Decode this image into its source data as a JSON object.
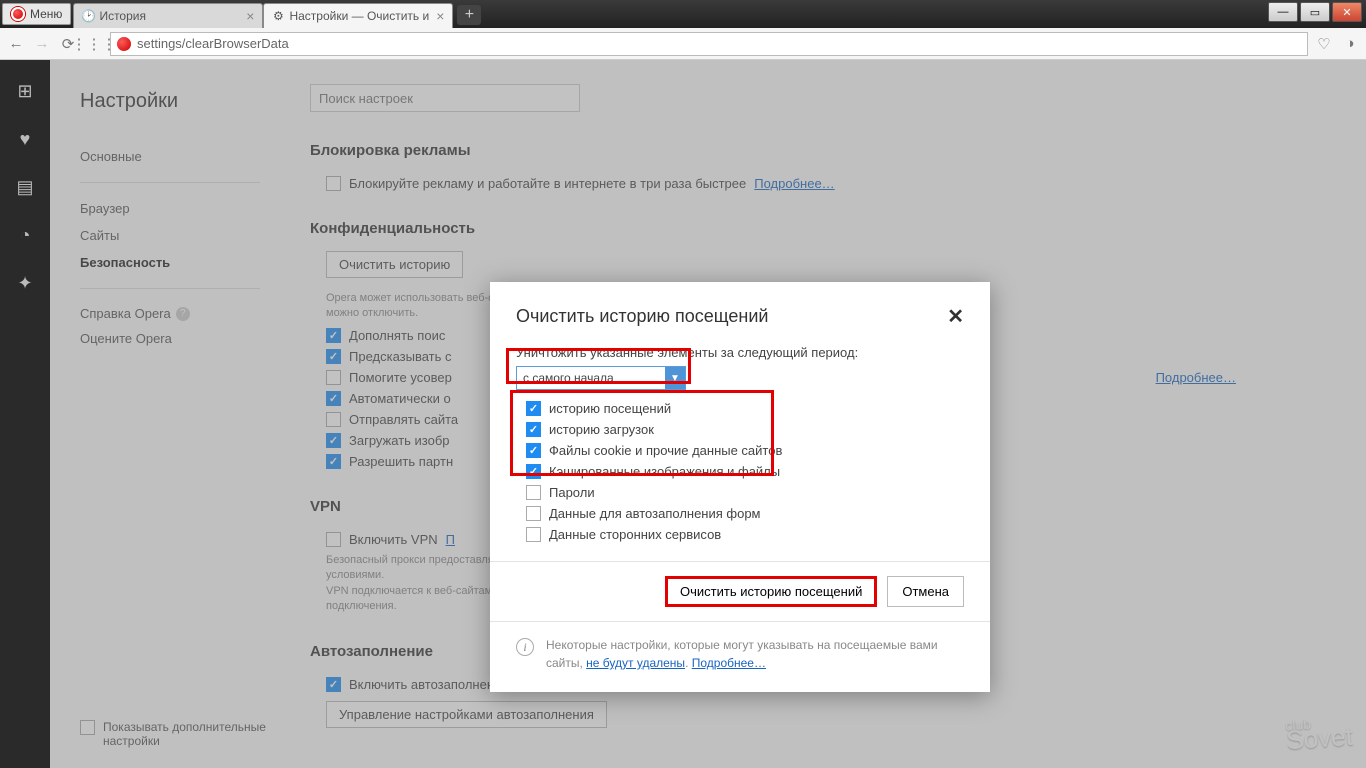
{
  "menu_label": "Меню",
  "tabs": [
    {
      "label": "История"
    },
    {
      "label": "Настройки — Очистить и"
    }
  ],
  "url": "settings/clearBrowserData",
  "sidebar": {
    "title": "Настройки",
    "items": [
      "Основные",
      "Браузер",
      "Сайты",
      "Безопасность"
    ],
    "help": "Справка Opera",
    "rate": "Оцените Opera",
    "advanced": "Показывать дополнительные настройки"
  },
  "search_placeholder": "Поиск настроек",
  "sections": {
    "ads": {
      "title": "Блокировка рекламы",
      "row": "Блокируйте рекламу и работайте в интернете в три раза быстрее",
      "more": "Подробнее…"
    },
    "privacy": {
      "title": "Конфиденциальность",
      "clear_btn": "Очистить историю",
      "desc": "Opera может использовать веб-службы для улучшения качества работы в интернете. При необходимости эти службы можно отключить.",
      "more": "Подробнее…",
      "rows": [
        "Дополнять поис",
        "Предсказывать с",
        "Помогите усовер",
        "Автоматически о",
        "Отправлять сайта",
        "Загружать изобр",
        "Разрешить партн"
      ]
    },
    "vpn": {
      "title": "VPN",
      "row": "Включить VPN",
      "more": "П",
      "note": "Безопасный прокси предоставляется нашими партнёрами. Включая данный параметр, вы подтверждаете согласие с условиями.\nVPN подключается к веб-сайтам через различные серверы по всему миру, что может отразиться на скорости подключения."
    },
    "autofill": {
      "title": "Автозаполнение",
      "row": "Включить автозаполнение форм на страницах",
      "manage": "Управление настройками автозаполнения"
    }
  },
  "modal": {
    "title": "Очистить историю посещений",
    "prompt": "Уничтожить указанные элементы за следующий период:",
    "period": "с самого начала",
    "items": [
      {
        "label": "историю посещений",
        "on": true
      },
      {
        "label": "историю загрузок",
        "on": true
      },
      {
        "label": "Файлы cookie и прочие данные сайтов",
        "on": true
      },
      {
        "label": "Кэшированные изображения и файлы",
        "on": true
      },
      {
        "label": "Пароли",
        "on": false
      },
      {
        "label": "Данные для автозаполнения форм",
        "on": false
      },
      {
        "label": "Данные сторонних сервисов",
        "on": false
      }
    ],
    "clear": "Очистить историю посещений",
    "cancel": "Отмена",
    "info": "Некоторые настройки, которые могут указывать на посещаемые вами сайты, ",
    "info_link": "не будут удалены",
    "info_more": "Подробнее…"
  },
  "watermark": {
    "top": "club",
    "bot": "Sovet"
  }
}
